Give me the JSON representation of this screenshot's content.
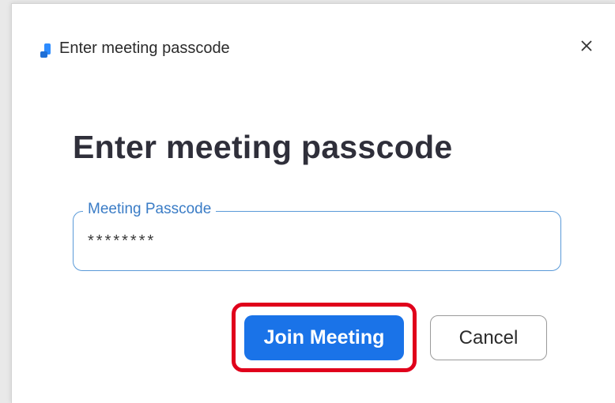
{
  "window": {
    "title": "Enter meeting passcode",
    "app_icon": "zoom-app-icon",
    "close_icon": "close-icon",
    "close_glyph": "✕"
  },
  "dialog": {
    "heading": "Enter meeting passcode",
    "passcode_field": {
      "label": "Meeting Passcode",
      "value": "********"
    },
    "buttons": {
      "join_label": "Join Meeting",
      "cancel_label": "Cancel"
    }
  },
  "colors": {
    "accent": "#1a73e8",
    "field_border": "#5a9ad8",
    "field_label": "#3a7cc6",
    "highlight": "#e0001b"
  }
}
